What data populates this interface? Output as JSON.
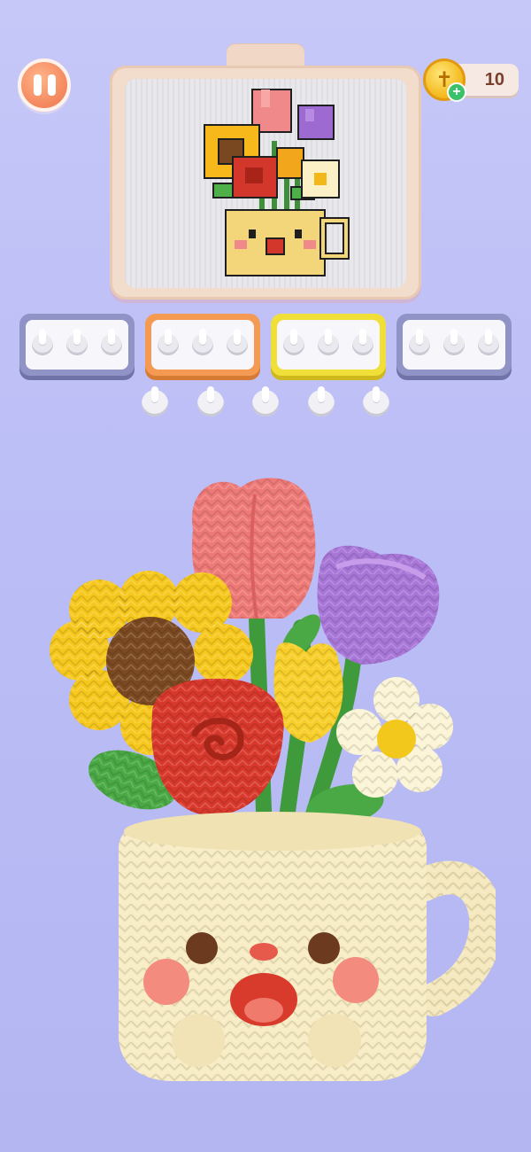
{
  "hud": {
    "coins": "10",
    "pause_icon": "pause-icon",
    "coin_icon": "coin-icon",
    "add_coins_icon": "plus-icon"
  },
  "target_picture": {
    "subject": "flower-bouquet-in-cup-pixel-art"
  },
  "slots": [
    {
      "color": "#8f93c6",
      "pegs": 3
    },
    {
      "color": "#f59a52",
      "pegs": 3
    },
    {
      "color": "#f1df39",
      "pegs": 3
    },
    {
      "color": "#8f93c6",
      "pegs": 3
    }
  ],
  "loose_pegs": 5,
  "colors": {
    "background": "#c0c2f6",
    "pause": "#f4865c",
    "coin": "#f3b81a",
    "tulip_pink": "#ee7a78",
    "tulip_purple": "#a877d8",
    "sunflower": "#f6c81e",
    "rose": "#d8392c",
    "daisy": "#fbf5d8",
    "cup": "#f7ecc3"
  }
}
